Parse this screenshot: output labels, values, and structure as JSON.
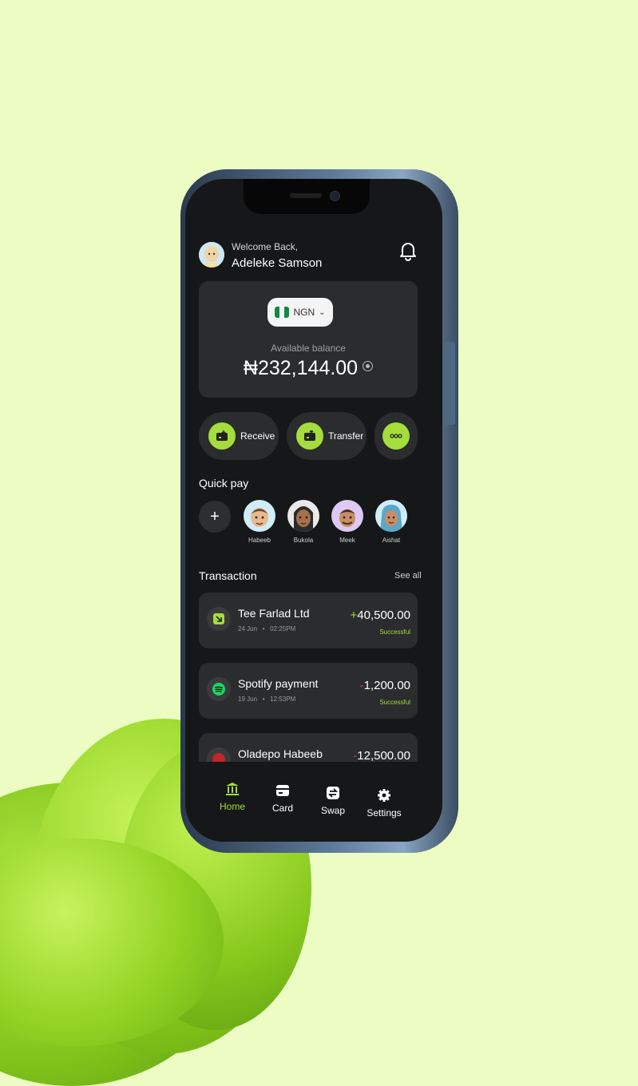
{
  "header": {
    "welcome": "Welcome Back,",
    "username": "Adeleke Samson"
  },
  "balance": {
    "currency_code": "NGN",
    "label": "Available balance",
    "amount": "₦232,144.00"
  },
  "actions": [
    {
      "label": "Receive"
    },
    {
      "label": "Transfer"
    }
  ],
  "quick_pay": {
    "title": "Quick pay",
    "add": "+",
    "contacts": [
      {
        "name": "Habeeb"
      },
      {
        "name": "Bukola"
      },
      {
        "name": "Meek"
      },
      {
        "name": "Aishat"
      }
    ]
  },
  "transactions": {
    "title": "Transaction",
    "see_all": "See all",
    "items": [
      {
        "title": "Tee Farlad Ltd",
        "date": "24 Jun",
        "time": "02:25PM",
        "sign": "+",
        "amount": "40,500.00",
        "status": "Successful"
      },
      {
        "title": "Spotify payment",
        "date": "19 Jun",
        "time": "12:53PM",
        "sign": "-",
        "amount": "1,200.00",
        "status": "Successful"
      },
      {
        "title": "Oladepo Habeeb",
        "sign": "-",
        "amount": "12,500.00"
      }
    ]
  },
  "nav": [
    {
      "label": "Home"
    },
    {
      "label": "Card"
    },
    {
      "label": "Swap"
    },
    {
      "label": "Settings"
    }
  ],
  "colors": {
    "accent": "#a4dd3c",
    "background": "#ecfcc3",
    "screen": "#161718",
    "card": "#2b2c2d"
  }
}
